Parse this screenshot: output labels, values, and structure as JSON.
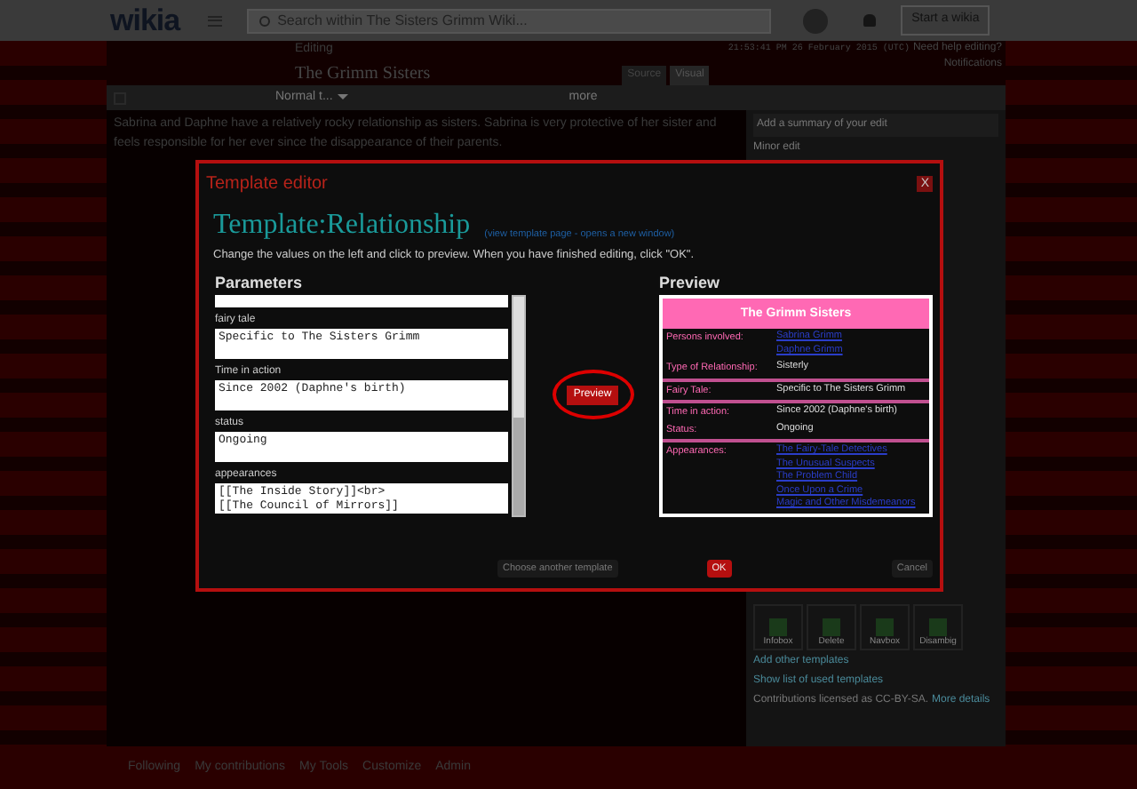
{
  "topbar": {
    "logo": "wikia",
    "search_placeholder": "Search within The Sisters Grimm Wiki...",
    "start_button": "Start a wikia"
  },
  "editor_header": {
    "label": "Editing",
    "title": "The Grimm Sisters",
    "timestamp": "21:53:41 PM 26 February 2015 (UTC)",
    "help": "Need help editing?",
    "notifications": "Notifications",
    "mode_tabs": [
      {
        "label": "Source",
        "selected": false
      },
      {
        "label": "Visual",
        "selected": true
      }
    ]
  },
  "toolbar": {
    "format": "Normal t...",
    "more": "more"
  },
  "article": {
    "lines": [
      "Sabrina and Daphne have a relatively rocky relationship as sisters. Sabrina is very protective of her sister and",
      "feels responsible for her ever since the disappearance of their parents."
    ]
  },
  "sidebar": {
    "summary_placeholder": "Add a summary of your edit",
    "minor_edit": "Minor edit",
    "templates": [
      "Infobox",
      "Delete",
      "Navbox",
      "Disambig"
    ],
    "links": [
      "Add other templates",
      "Show list of used templates"
    ],
    "license": "Contributions licensed as CC-BY-SA.",
    "license_link": "More details"
  },
  "bottom_bar": [
    "Following",
    "My contributions",
    "My Tools",
    "Customize",
    "Admin"
  ],
  "modal": {
    "title": "Template editor",
    "close": "X",
    "template_name": "Template:Relationship",
    "view_link": "(view template page - opens a new window)",
    "instructions": "Change the values on the left and click to preview. When you have finished editing, click \"OK\".",
    "parameters_heading": "Parameters",
    "parameters": [
      {
        "label": "fairy tale",
        "value": "Specific to The Sisters Grimm"
      },
      {
        "label": "Time in action",
        "value": "Since 2002 (Daphne's birth)"
      },
      {
        "label": "status",
        "value": "Ongoing"
      },
      {
        "label": "appearances",
        "value": "[[The Inside Story]]<br>\n[[The Council of Mirrors]]"
      }
    ],
    "preview_button": {
      "label": "Preview",
      "circled": true
    },
    "preview_heading": "Preview",
    "preview": {
      "title": "The Grimm Sisters",
      "rows": [
        {
          "label": "Persons involved:",
          "values": [
            "Sabrina Grimm",
            "Daphne Grimm"
          ],
          "link": true,
          "divider": false
        },
        {
          "label": "Type of Relationship:",
          "values": [
            "Sisterly"
          ],
          "link": false,
          "divider": true
        },
        {
          "label": "Fairy Tale:",
          "values": [
            "Specific to The Sisters Grimm"
          ],
          "link": false,
          "divider": true
        },
        {
          "label": "Time in action:",
          "values": [
            "Since 2002 (Daphne's birth)"
          ],
          "link": false,
          "divider": false
        },
        {
          "label": "Status:",
          "values": [
            "Ongoing"
          ],
          "link": false,
          "divider": true
        },
        {
          "label": "Appearances:",
          "values": [
            "The Fairy-Tale Detectives",
            "The Unusual Suspects",
            "The Problem Child",
            "Once Upon a Crime",
            "Magic and Other Misdemeanors"
          ],
          "link": true,
          "divider": false
        }
      ]
    },
    "buttons": [
      {
        "label": "Choose another template",
        "kind": "secondary"
      },
      {
        "label": "OK",
        "kind": "primary"
      },
      {
        "label": "Cancel",
        "kind": "secondary"
      }
    ]
  }
}
